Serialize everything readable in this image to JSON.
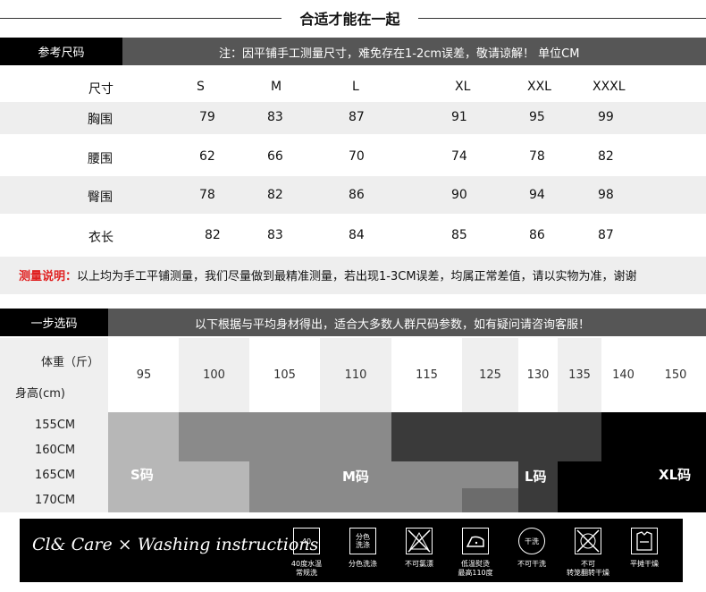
{
  "title": "合适才能在一起",
  "size_section": {
    "label": "参考尺码",
    "note": "注：因平铺手工测量尺寸，难免存在1-2cm误差，敬请谅解！ 单位CM",
    "headers": [
      "尺寸",
      "S",
      "M",
      "L",
      "XL",
      "XXL",
      "XXXL"
    ],
    "rows": [
      {
        "name": "胸围",
        "values": [
          "79",
          "83",
          "87",
          "91",
          "95",
          "99"
        ]
      },
      {
        "name": "腰围",
        "values": [
          "62",
          "66",
          "70",
          "74",
          "78",
          "82"
        ]
      },
      {
        "name": "臀围",
        "values": [
          "78",
          "82",
          "86",
          "90",
          "94",
          "98"
        ]
      },
      {
        "name": "衣长",
        "values": [
          "82",
          "83",
          "84",
          "85",
          "86",
          "87"
        ]
      }
    ],
    "measure_label": "测量说明：",
    "measure_text": "以上均为手工平铺测量，我们尽量做到最精准测量，若出现1-3CM误差，均属正常差值，请以实物为准，谢谢"
  },
  "fit_section": {
    "label": "一步选码",
    "note": "以下根据与平均身材得出，适合大多数人群尺码参数，如有疑问请咨询客服！",
    "weight_label": "体重（斤）",
    "height_label": "身高(cm)",
    "weights": [
      "95",
      "100",
      "105",
      "110",
      "115",
      "125",
      "130",
      "135",
      "140",
      "150"
    ],
    "heights": [
      "155CM",
      "160CM",
      "165CM",
      "170CM"
    ],
    "sizes": [
      "S码",
      "M码",
      "L码",
      "XL码"
    ]
  },
  "washing": {
    "title": "Cl& Care × Washing instructions",
    "items": [
      {
        "icon": "wash-40-icon",
        "label": "40度水温\n常规洗",
        "glyph": "40"
      },
      {
        "icon": "separate-wash-icon",
        "label": "分色洗涤",
        "glyph": "分色\n洗涤"
      },
      {
        "icon": "no-bleach-icon",
        "label": "不可氯漂",
        "glyph": ""
      },
      {
        "icon": "iron-low-icon",
        "label": "低温熨烫\n最高110度",
        "glyph": ""
      },
      {
        "icon": "no-dryclean-icon",
        "label": "不可干洗",
        "glyph": "干洗"
      },
      {
        "icon": "no-tumble-dry-icon",
        "label": "不可\n转笼翻转干燥",
        "glyph": ""
      },
      {
        "icon": "flat-dry-icon",
        "label": "平摊干燥",
        "glyph": ""
      }
    ]
  },
  "colors": {
    "dark_bar": "#565656",
    "black": "#000000",
    "light_row": "#eeeeee",
    "red": "#e02020"
  }
}
